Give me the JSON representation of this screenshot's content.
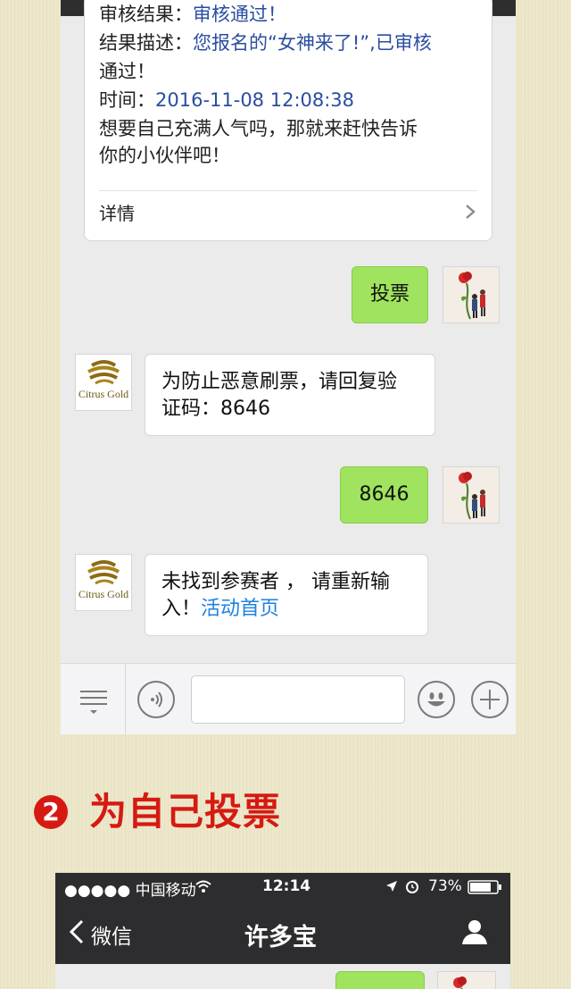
{
  "top_chat": {
    "card": {
      "line0_label": "审核结果：",
      "line0_value": "审核通过！",
      "line1_label": "结果描述：",
      "line1_value": "您报名的“女神来了!”,已审核",
      "line2": "通过！",
      "line3_label": "时间：",
      "line3_value": "2016-11-08 12:08:38",
      "line4": "想要自己充满人气吗，那就来赶快告诉",
      "line5": "你的小伙伴吧！",
      "detail_label": "详情"
    },
    "messages": [
      {
        "from": "user",
        "text": "投票"
      },
      {
        "from": "account",
        "line1": "为防止恶意刷票，请回复验",
        "line2": "证码：8646"
      },
      {
        "from": "user",
        "text": "8646"
      },
      {
        "from": "account",
        "line1": "未找到参赛者 ， 请重新输",
        "line2_prefix": "入！",
        "line2_link": "活动首页"
      }
    ],
    "account_avatar_text": "Citrus Gold"
  },
  "step": {
    "number": "2",
    "title": "为自己投票"
  },
  "bottom_phone": {
    "status": {
      "carrier": "●●●●● 中国移动",
      "time": "12:14",
      "battery": "73%"
    },
    "nav": {
      "back_label": "微信",
      "title": "许多宝"
    }
  },
  "colors": {
    "accent_red": "#D61A12",
    "bubble_green": "#9FE35E",
    "link_blue": "#1E82E0",
    "card_blue": "#2A4DA0"
  }
}
